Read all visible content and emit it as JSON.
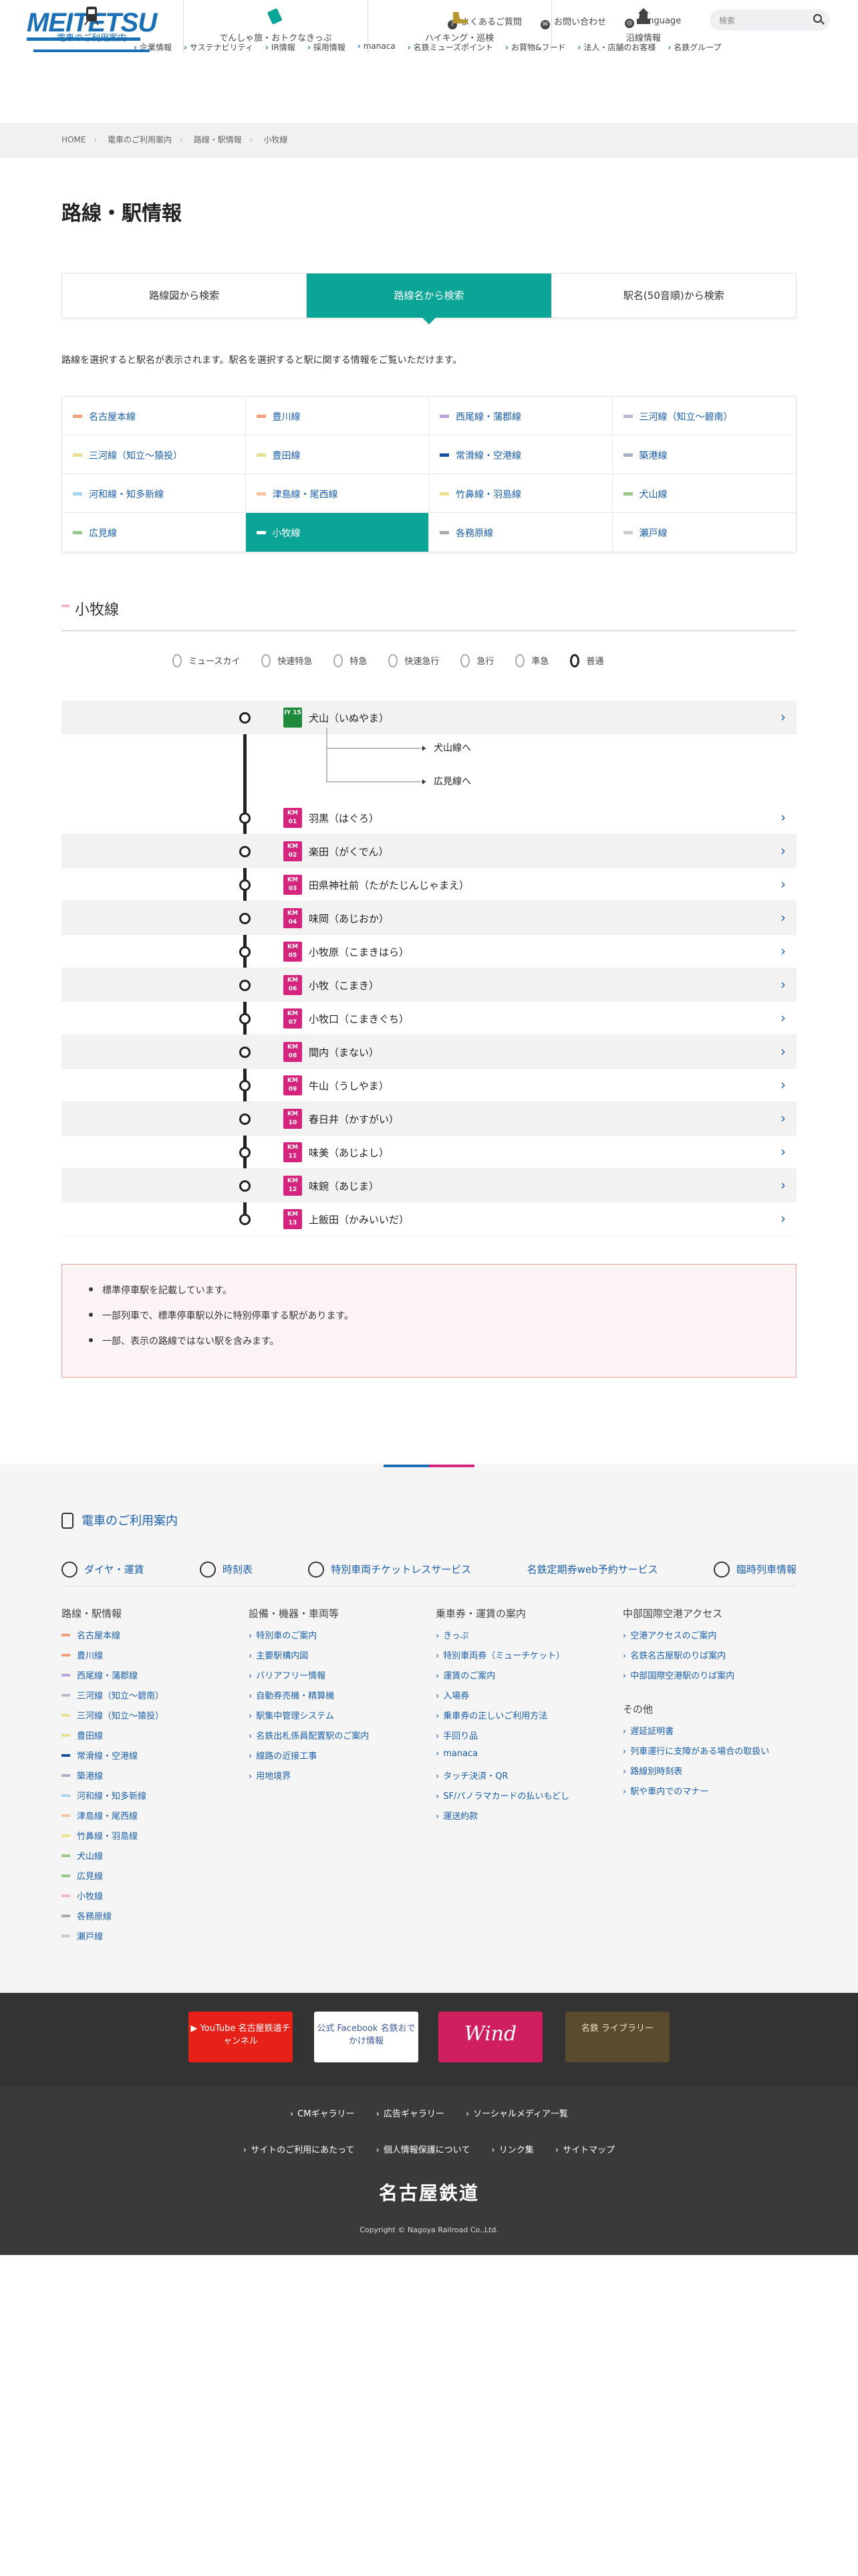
{
  "header": {
    "logo": "MEITETSU",
    "utility": [
      "よくあるご質問",
      "お問い合わせ",
      "Language"
    ],
    "search_placeholder": "検索",
    "subnav": [
      "企業情報",
      "サステナビリティ",
      "IR情報",
      "採用情報",
      "manaca",
      "名鉄ミューズポイント",
      "お買物&フード",
      "法人・店舗のお客様",
      "名鉄グループ"
    ],
    "mainnav": [
      "電車のご利用案内",
      "でんしゃ旅・おトクなきっぷ",
      "ハイキング・巡検",
      "沿線情報"
    ]
  },
  "breadcrumb": [
    "HOME",
    "電車のご利用案内",
    "路線・駅情報",
    "小牧線"
  ],
  "page_title": "路線・駅情報",
  "tabs": [
    "路線図から検索",
    "路線名から検索",
    "駅名(50音順)から検索"
  ],
  "intro": "路線を選択すると駅名が表示されます。駅名を選択すると駅に関する情報をご覧いただけます。",
  "lines": [
    {
      "label": "名古屋本線",
      "color": "#f0a07a"
    },
    {
      "label": "豊川線",
      "color": "#f0a07a"
    },
    {
      "label": "西尾線・蒲郡線",
      "color": "#b7a3d8"
    },
    {
      "label": "三河線（知立〜碧南）",
      "color": "#b9b9d0"
    },
    {
      "label": "三河線（知立〜猿投）",
      "color": "#e8e090"
    },
    {
      "label": "豊田線",
      "color": "#e8e090"
    },
    {
      "label": "常滑線・空港線",
      "color": "#1a4f9b"
    },
    {
      "label": "築港線",
      "color": "#aab0c8"
    },
    {
      "label": "河和線・知多新線",
      "color": "#a9d6ec"
    },
    {
      "label": "津島線・尾西線",
      "color": "#f6c3a3"
    },
    {
      "label": "竹鼻線・羽島線",
      "color": "#efe28f"
    },
    {
      "label": "犬山線",
      "color": "#9ac78a"
    },
    {
      "label": "広見線",
      "color": "#9ac78a"
    },
    {
      "label": "小牧線",
      "color": "#ffffff"
    },
    {
      "label": "各務原線",
      "color": "#aaaaaa"
    },
    {
      "label": "瀬戸線",
      "color": "#cccccc"
    }
  ],
  "line_heading": "小牧線",
  "legend": [
    "ミュースカイ",
    "快速特急",
    "特急",
    "快速急行",
    "急行",
    "準急",
    "普通"
  ],
  "stations": [
    {
      "code": "IY 15",
      "name": "犬山（いぬやま）"
    },
    {
      "code": "KM 01",
      "name": "羽黒（はぐろ）"
    },
    {
      "code": "KM 02",
      "name": "楽田（がくでん）"
    },
    {
      "code": "KM 03",
      "name": "田県神社前（たがたじんじゃまえ）"
    },
    {
      "code": "KM 04",
      "name": "味岡（あじおか）"
    },
    {
      "code": "KM 05",
      "name": "小牧原（こまきはら）"
    },
    {
      "code": "KM 06",
      "name": "小牧（こまき）"
    },
    {
      "code": "KM 07",
      "name": "小牧口（こまきぐち）"
    },
    {
      "code": "KM 08",
      "name": "間内（まない）"
    },
    {
      "code": "KM 09",
      "name": "牛山（うしやま）"
    },
    {
      "code": "KM 10",
      "name": "春日井（かすがい）"
    },
    {
      "code": "KM 11",
      "name": "味美（あじよし）"
    },
    {
      "code": "KM 12",
      "name": "味鋺（あじま）"
    },
    {
      "code": "KM 13",
      "name": "上飯田（かみいいだ）"
    }
  ],
  "branches": [
    "犬山線へ",
    "広見線へ"
  ],
  "notes": [
    "標準停車駅を記載しています。",
    "一部列車で、標準停車駅以外に特別停車する駅があります。",
    "一部、表示の路線ではない駅を含みます。"
  ],
  "footer": {
    "heading": "電車のご利用案内",
    "quick": [
      "ダイヤ・運賃",
      "時刻表",
      "特別車両チケットレスサービス",
      "名鉄定期券web予約サービス",
      "臨時列車情報"
    ],
    "col1": {
      "title": "路線・駅情報",
      "items": [
        {
          "label": "名古屋本線",
          "color": "#f0a07a"
        },
        {
          "label": "豊川線",
          "color": "#f0a07a"
        },
        {
          "label": "西尾線・蒲郡線",
          "color": "#b7a3d8"
        },
        {
          "label": "三河線（知立〜碧南）",
          "color": "#b9b9d0"
        },
        {
          "label": "三河線（知立〜猿投）",
          "color": "#e8e090"
        },
        {
          "label": "豊田線",
          "color": "#e8e090"
        },
        {
          "label": "常滑線・空港線",
          "color": "#1a4f9b"
        },
        {
          "label": "築港線",
          "color": "#aab0c8"
        },
        {
          "label": "河和線・知多新線",
          "color": "#a9d6ec"
        },
        {
          "label": "津島線・尾西線",
          "color": "#f6c3a3"
        },
        {
          "label": "竹鼻線・羽島線",
          "color": "#efe28f"
        },
        {
          "label": "犬山線",
          "color": "#9ac78a"
        },
        {
          "label": "広見線",
          "color": "#9ac78a"
        },
        {
          "label": "小牧線",
          "color": "#f2b8c2"
        },
        {
          "label": "各務原線",
          "color": "#aaaaaa"
        },
        {
          "label": "瀬戸線",
          "color": "#cccccc"
        }
      ]
    },
    "col2": {
      "title": "設備・機器・車両等",
      "items": [
        "特別車のご案内",
        "主要駅構内図",
        "バリアフリー情報",
        "自動券売機・精算機",
        "駅集中管理システム",
        "名鉄出札係員配置駅のご案内",
        "線路の近接工事",
        "用地境界"
      ]
    },
    "col3": {
      "title": "乗車券・運賃の案内",
      "items": [
        "きっぷ",
        "特別車両券（ミューチケット）",
        "運賃のご案内",
        "入場券",
        "乗車券の正しいご利用方法",
        "手回り品",
        "manaca",
        "タッチ決済・QR",
        "SF/パノラマカードの払いもどし",
        "運送約款"
      ]
    },
    "col4": {
      "title": "中部国際空港アクセス",
      "items": [
        "空港アクセスのご案内",
        "名鉄名古屋駅のりば案内",
        "中部国際空港駅のりば案内"
      ]
    },
    "col4b": {
      "title": "その他",
      "items": [
        "遅延証明書",
        "列車運行に支障がある場合の取扱い",
        "路線別時刻表",
        "駅や車内でのマナー"
      ]
    },
    "banners": [
      "YouTube 名古屋鉄道チャンネル",
      "公式 Facebook 名鉄おでかけ情報",
      "Wind",
      "名鉄 ライブラリー"
    ],
    "links1": [
      "CMギャラリー",
      "広告ギャラリー",
      "ソーシャルメディア一覧"
    ],
    "links2": [
      "サイトのご利用にあたって",
      "個人情報保護について",
      "リンク集",
      "サイトマップ"
    ],
    "corp_name": "名古屋鉄道",
    "copyright": "Copyright © Nagoya Railroad Co.,Ltd."
  }
}
